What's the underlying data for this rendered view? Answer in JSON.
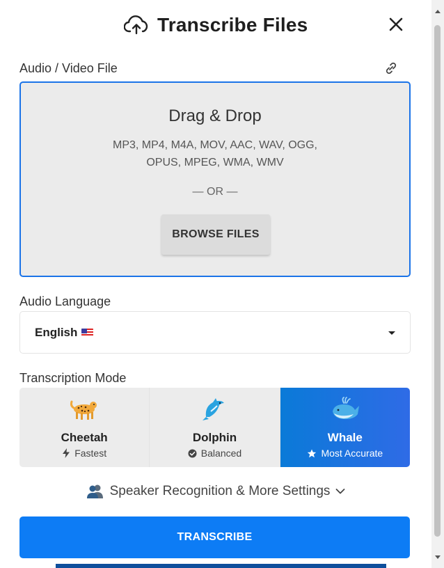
{
  "header": {
    "title": "Transcribe Files",
    "upload_icon": "cloud-upload-icon",
    "close_icon": "close-icon"
  },
  "file_section": {
    "label": "Audio / Video File",
    "link_icon": "link-icon",
    "dropzone": {
      "title": "Drag & Drop",
      "formats_line1": "MP3, MP4, M4A, MOV, AAC, WAV, OGG,",
      "formats_line2": "OPUS, MPEG, WMA, WMV",
      "or_text": "— OR —",
      "browse_label": "BROWSE FILES"
    }
  },
  "language_section": {
    "label": "Audio Language",
    "selected": "English",
    "flag_icon": "us-flag-icon"
  },
  "mode_section": {
    "label": "Transcription Mode",
    "modes": [
      {
        "name": "Cheetah",
        "emoji": "🐆",
        "sub": "Fastest",
        "sub_icon": "lightning-icon",
        "active": false
      },
      {
        "name": "Dolphin",
        "emoji": "🐬",
        "sub": "Balanced",
        "sub_icon": "check-circle-icon",
        "active": false
      },
      {
        "name": "Whale",
        "emoji": "🐳",
        "sub": "Most Accurate",
        "sub_icon": "star-icon",
        "active": true
      }
    ]
  },
  "more_settings": {
    "label": "Speaker Recognition & More Settings",
    "icon": "people-icon",
    "chevron": "chevron-down-icon"
  },
  "transcribe_button": {
    "label": "TRANSCRIBE"
  },
  "colors": {
    "accent": "#0d7cf5",
    "dropzone_border": "#1a73e8",
    "active_mode_start": "#0a7ad8",
    "active_mode_end": "#2f6be6"
  }
}
